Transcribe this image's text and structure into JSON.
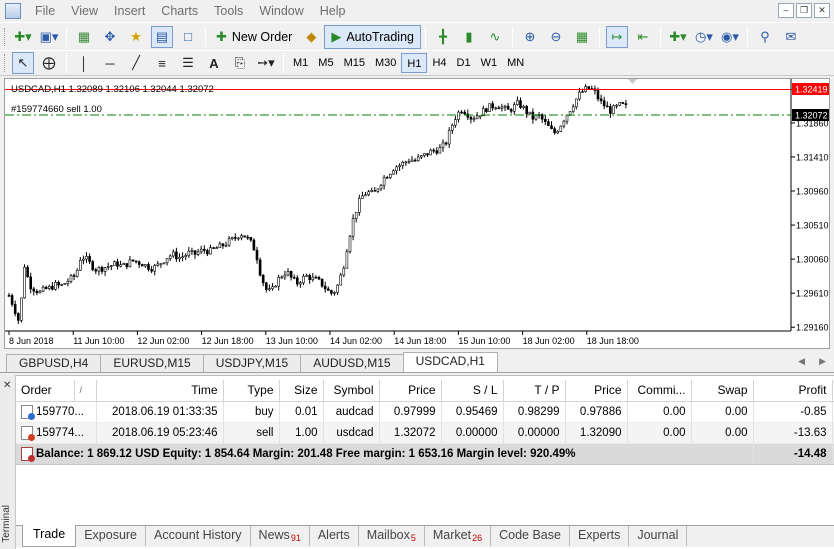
{
  "menu": [
    "File",
    "View",
    "Insert",
    "Charts",
    "Tools",
    "Window",
    "Help"
  ],
  "toolbar": {
    "new_order": "New Order",
    "autotrading": "AutoTrading"
  },
  "timeframes": [
    "M1",
    "M5",
    "M15",
    "M30",
    "H1",
    "H4",
    "D1",
    "W1",
    "MN"
  ],
  "active_timeframe": "H1",
  "chart": {
    "header": "USDCAD,H1  1.32089 1.32106 1.32044 1.32072",
    "order_line_label": "#159774660 sell 1.00",
    "ask_price_box": "1.32419",
    "bid_price_box": "1.32072",
    "colors": {
      "ask_line": "#ff0000",
      "order_line": "#008000",
      "bid_box": "#000000"
    }
  },
  "chart_data": {
    "type": "candlestick",
    "symbol": "USDCAD",
    "timeframe": "H1",
    "y_ticks": [
      "1.32300",
      "1.31860",
      "1.31410",
      "1.30960",
      "1.30510",
      "1.30060",
      "1.29610",
      "1.29160"
    ],
    "y_tick_values": [
      1.323,
      1.3186,
      1.3141,
      1.3096,
      1.3051,
      1.3006,
      1.2961,
      1.2916
    ],
    "ylim": [
      1.2911,
      1.3244
    ],
    "x_ticks": [
      "8 Jun 2018",
      "11 Jun 10:00",
      "12 Jun 02:00",
      "12 Jun 18:00",
      "13 Jun 10:00",
      "14 Jun 02:00",
      "14 Jun 18:00",
      "15 Jun 10:00",
      "18 Jun 02:00",
      "18 Jun 18:00"
    ],
    "close_path": [
      1.2958,
      1.2942,
      1.2922,
      1.2998,
      1.2972,
      1.2966,
      1.2962,
      1.2966,
      1.2968,
      1.2972,
      1.297,
      1.2975,
      1.298,
      1.2985,
      1.301,
      1.3006,
      1.2998,
      1.2992,
      1.2994,
      1.2996,
      1.2998,
      1.3,
      1.2996,
      1.3,
      1.3004,
      1.3002,
      1.3,
      1.2996,
      1.2994,
      1.2998,
      1.3004,
      1.301,
      1.3012,
      1.3008,
      1.301,
      1.3014,
      1.3012,
      1.3016,
      1.3018,
      1.3016,
      1.302,
      1.3022,
      1.3026,
      1.303,
      1.3034,
      1.304,
      1.3036,
      1.3028,
      1.3016,
      1.2984,
      1.2966,
      1.2962,
      1.2976,
      1.2984,
      1.299,
      1.298,
      1.2974,
      1.298,
      1.2984,
      1.298,
      1.2978,
      1.2972,
      1.2964,
      1.296,
      1.2972,
      1.2994,
      1.303,
      1.306,
      1.308,
      1.3092,
      1.3094,
      1.3092,
      1.3104,
      1.3114,
      1.312,
      1.3128,
      1.313,
      1.3134,
      1.3138,
      1.3136,
      1.314,
      1.3144,
      1.3148,
      1.315,
      1.3152,
      1.316,
      1.318,
      1.3196,
      1.3204,
      1.32,
      1.3192,
      1.3196,
      1.32,
      1.3206,
      1.3208,
      1.321,
      1.3206,
      1.3202,
      1.3206,
      1.3212,
      1.3206,
      1.3198,
      1.3192,
      1.3196,
      1.3188,
      1.318,
      1.3172,
      1.318,
      1.3192,
      1.3202,
      1.3214,
      1.3224,
      1.323,
      1.3232,
      1.3226,
      1.3214,
      1.3208,
      1.3202,
      1.3206,
      1.321,
      1.3207
    ]
  },
  "chart_tabs": [
    "GBPUSD,H4",
    "EURUSD,M15",
    "USDJPY,M15",
    "AUDUSD,M15",
    "USDCAD,H1"
  ],
  "active_chart_tab": "USDCAD,H1",
  "terminal": {
    "label": "Terminal",
    "columns": [
      "Order",
      "/",
      "Time",
      "Type",
      "Size",
      "Symbol",
      "Price",
      "S / L",
      "T / P",
      "Price",
      "Commi...",
      "Swap",
      "Profit"
    ],
    "rows": [
      {
        "order": "159770...",
        "time": "2018.06.19 01:33:35",
        "type": "buy",
        "size": "0.01",
        "symbol": "audcad",
        "price": "0.97999",
        "sl": "0.95469",
        "tp": "0.98299",
        "cur_price": "0.97886",
        "commission": "0.00",
        "swap": "0.00",
        "profit": "-0.85"
      },
      {
        "order": "159774...",
        "time": "2018.06.19 05:23:46",
        "type": "sell",
        "size": "1.00",
        "symbol": "usdcad",
        "price": "1.32072",
        "sl": "0.00000",
        "tp": "0.00000",
        "cur_price": "1.32090",
        "commission": "0.00",
        "swap": "0.00",
        "profit": "-13.63"
      }
    ],
    "balance_line": "Balance: 1 869.12 USD  Equity: 1 854.64  Margin: 201.48  Free margin: 1 653.16  Margin level: 920.49%",
    "balance_profit": "-14.48"
  },
  "bottom_tabs": [
    {
      "label": "Trade",
      "badge": ""
    },
    {
      "label": "Exposure",
      "badge": ""
    },
    {
      "label": "Account History",
      "badge": ""
    },
    {
      "label": "News",
      "badge": "91"
    },
    {
      "label": "Alerts",
      "badge": ""
    },
    {
      "label": "Mailbox",
      "badge": "5"
    },
    {
      "label": "Market",
      "badge": "26"
    },
    {
      "label": "Code Base",
      "badge": ""
    },
    {
      "label": "Experts",
      "badge": ""
    },
    {
      "label": "Journal",
      "badge": ""
    }
  ],
  "active_bottom_tab": "Trade"
}
